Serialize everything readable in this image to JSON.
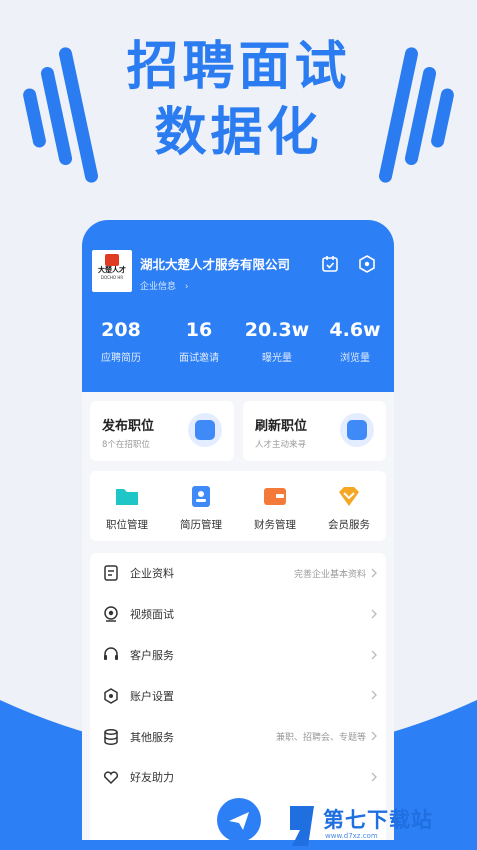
{
  "headline": {
    "line1": "招聘面试",
    "line2": "数据化"
  },
  "company": {
    "logo_text": "大楚人才",
    "logo_sub": "DOCHO HR",
    "name": "湖北大楚人才服务有限公司",
    "info_link": "企业信息",
    "info_chevron": "›"
  },
  "stats": [
    {
      "value": "208",
      "label": "应聘简历"
    },
    {
      "value": "16",
      "label": "面试邀请"
    },
    {
      "value": "20.3w",
      "label": "曝光量"
    },
    {
      "value": "4.6w",
      "label": "浏览量"
    }
  ],
  "cards": {
    "post": {
      "title": "发布职位",
      "desc": "8个在招职位"
    },
    "refresh": {
      "title": "刷新职位",
      "desc": "人才主动来寻"
    }
  },
  "quick": [
    {
      "label": "职位管理",
      "icon": "folder-icon"
    },
    {
      "label": "简历管理",
      "icon": "resume-icon"
    },
    {
      "label": "财务管理",
      "icon": "wallet-icon"
    },
    {
      "label": "会员服务",
      "icon": "diamond-icon"
    }
  ],
  "menu": [
    {
      "label": "企业资料",
      "hint": "完善企业基本资料",
      "icon": "document-icon"
    },
    {
      "label": "视频面试",
      "hint": "",
      "icon": "camera-icon"
    },
    {
      "label": "客户服务",
      "hint": "",
      "icon": "headset-icon"
    },
    {
      "label": "账户设置",
      "hint": "",
      "icon": "settings-icon"
    },
    {
      "label": "其他服务",
      "hint": "兼职、招聘会、专题等",
      "icon": "database-icon"
    },
    {
      "label": "好友助力",
      "hint": "",
      "icon": "heart-handshake-icon"
    }
  ],
  "watermark": {
    "text": "第七下载站",
    "url": "www.d7xz.com"
  },
  "colors": {
    "primary": "#2d7ff5",
    "headline": "#2b7cf0",
    "background": "#eef1f8",
    "orange": "#f47a3a",
    "gold": "#f5a623",
    "teal": "#1ec6c8"
  }
}
